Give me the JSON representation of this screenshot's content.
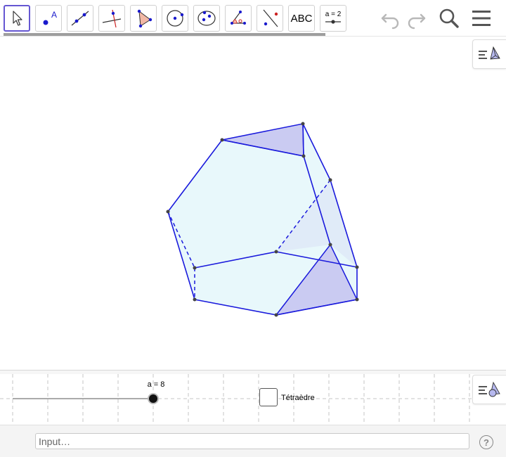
{
  "toolbar": {
    "tools": [
      {
        "name": "move-tool",
        "label": "",
        "icon": "arrow-cursor-icon",
        "selected": true
      },
      {
        "name": "point-tool",
        "label": "A",
        "icon": "point-icon"
      },
      {
        "name": "line-tool",
        "label": "",
        "icon": "line-through-points-icon"
      },
      {
        "name": "perpendicular-line-tool",
        "label": "",
        "icon": "perpendicular-line-icon"
      },
      {
        "name": "polygon-tool",
        "label": "",
        "icon": "polygon-icon"
      },
      {
        "name": "circle-tool",
        "label": "",
        "icon": "circle-center-point-icon"
      },
      {
        "name": "conic-tool",
        "label": "",
        "icon": "ellipse-icon"
      },
      {
        "name": "angle-tool",
        "label": "",
        "icon": "angle-icon"
      },
      {
        "name": "reflect-tool",
        "label": "",
        "icon": "reflect-point-line-icon"
      },
      {
        "name": "text-tool",
        "label": "ABC",
        "icon": "text-icon"
      },
      {
        "name": "slider-tool",
        "label": "a = 2",
        "icon": "slider-icon"
      }
    ],
    "undo_icon": "undo-icon",
    "redo_icon": "redo-icon",
    "search_icon": "search-icon",
    "menu_icon": "menu-icon"
  },
  "graphics": {
    "style_bar_icon": "graphics-style-bar-icon",
    "colors": {
      "edge": "#1a1adc",
      "face": "#e6f6fa",
      "triangle": "#c8c8f0",
      "vertex": "#444444"
    }
  },
  "panel2": {
    "style_bar_icon": "graphics2-style-bar-icon",
    "slider": {
      "label": "a = 8",
      "value": 8,
      "min": 0,
      "max": 8
    },
    "checkbox": {
      "label": "Tétraèdre",
      "checked": false
    }
  },
  "input_bar": {
    "placeholder": "Input…",
    "value": ""
  },
  "help": {
    "label": "?"
  }
}
